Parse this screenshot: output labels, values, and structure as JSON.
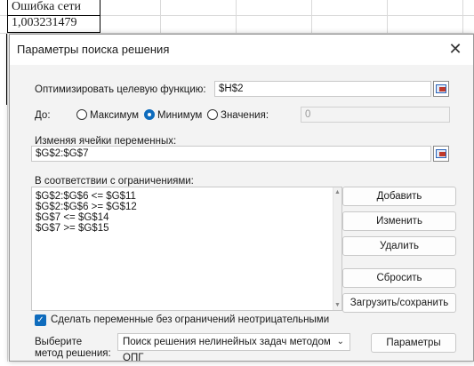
{
  "sheet": {
    "header_cell": "Ошибка сети",
    "value_cell": "1,003231479"
  },
  "dialog": {
    "title": "Параметры поиска решения",
    "objective_label": "Оптимизировать целевую функцию:",
    "objective_value": "$H$2",
    "to_label": "До:",
    "opt_max": "Максимум",
    "opt_min": "Минимум",
    "opt_value": "Значения:",
    "value_field": "0",
    "selected_option": "Минимум",
    "changing_label": "Изменяя ячейки переменных:",
    "changing_value": "$G$2:$G$7",
    "constraints_label": "В соответствии с ограничениями:",
    "constraints": [
      "$G$2:$G$6 <= $G$11",
      "$G$2:$G$6 >= $G$12",
      "$G$7 <= $G$14",
      "$G$7 >= $G$15"
    ],
    "buttons": {
      "add": "Добавить",
      "change": "Изменить",
      "delete": "Удалить",
      "reset": "Сбросить",
      "load_save": "Загрузить/сохранить",
      "options": "Параметры"
    },
    "nonneg_label": "Сделать переменные без ограничений неотрицательными",
    "nonneg_checked": true,
    "method_label_1": "Выберите",
    "method_label_2": "метод решения:",
    "method_value": "Поиск решения нелинейных задач методом ОПГ"
  },
  "colors": {
    "accent": "#0f6cbd",
    "dialog_bg": "#f3f3f3"
  },
  "icons": [
    "close-icon",
    "range-select-icon",
    "checkmark-icon",
    "chevron-down-icon"
  ]
}
